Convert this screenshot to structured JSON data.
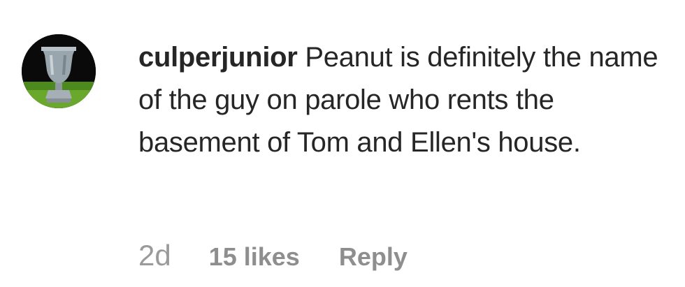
{
  "comment": {
    "username": "culperjunior",
    "text": "Peanut is definitely the name of the guy on parole who rents the basement of Tom and Ellen's house.",
    "time": "2d",
    "likes": "15 likes",
    "reply_label": "Reply",
    "avatar_icon": "garden-urn-avatar"
  },
  "colors": {
    "text": "#262626",
    "meta": "#8e8e8e",
    "background": "#ffffff"
  }
}
